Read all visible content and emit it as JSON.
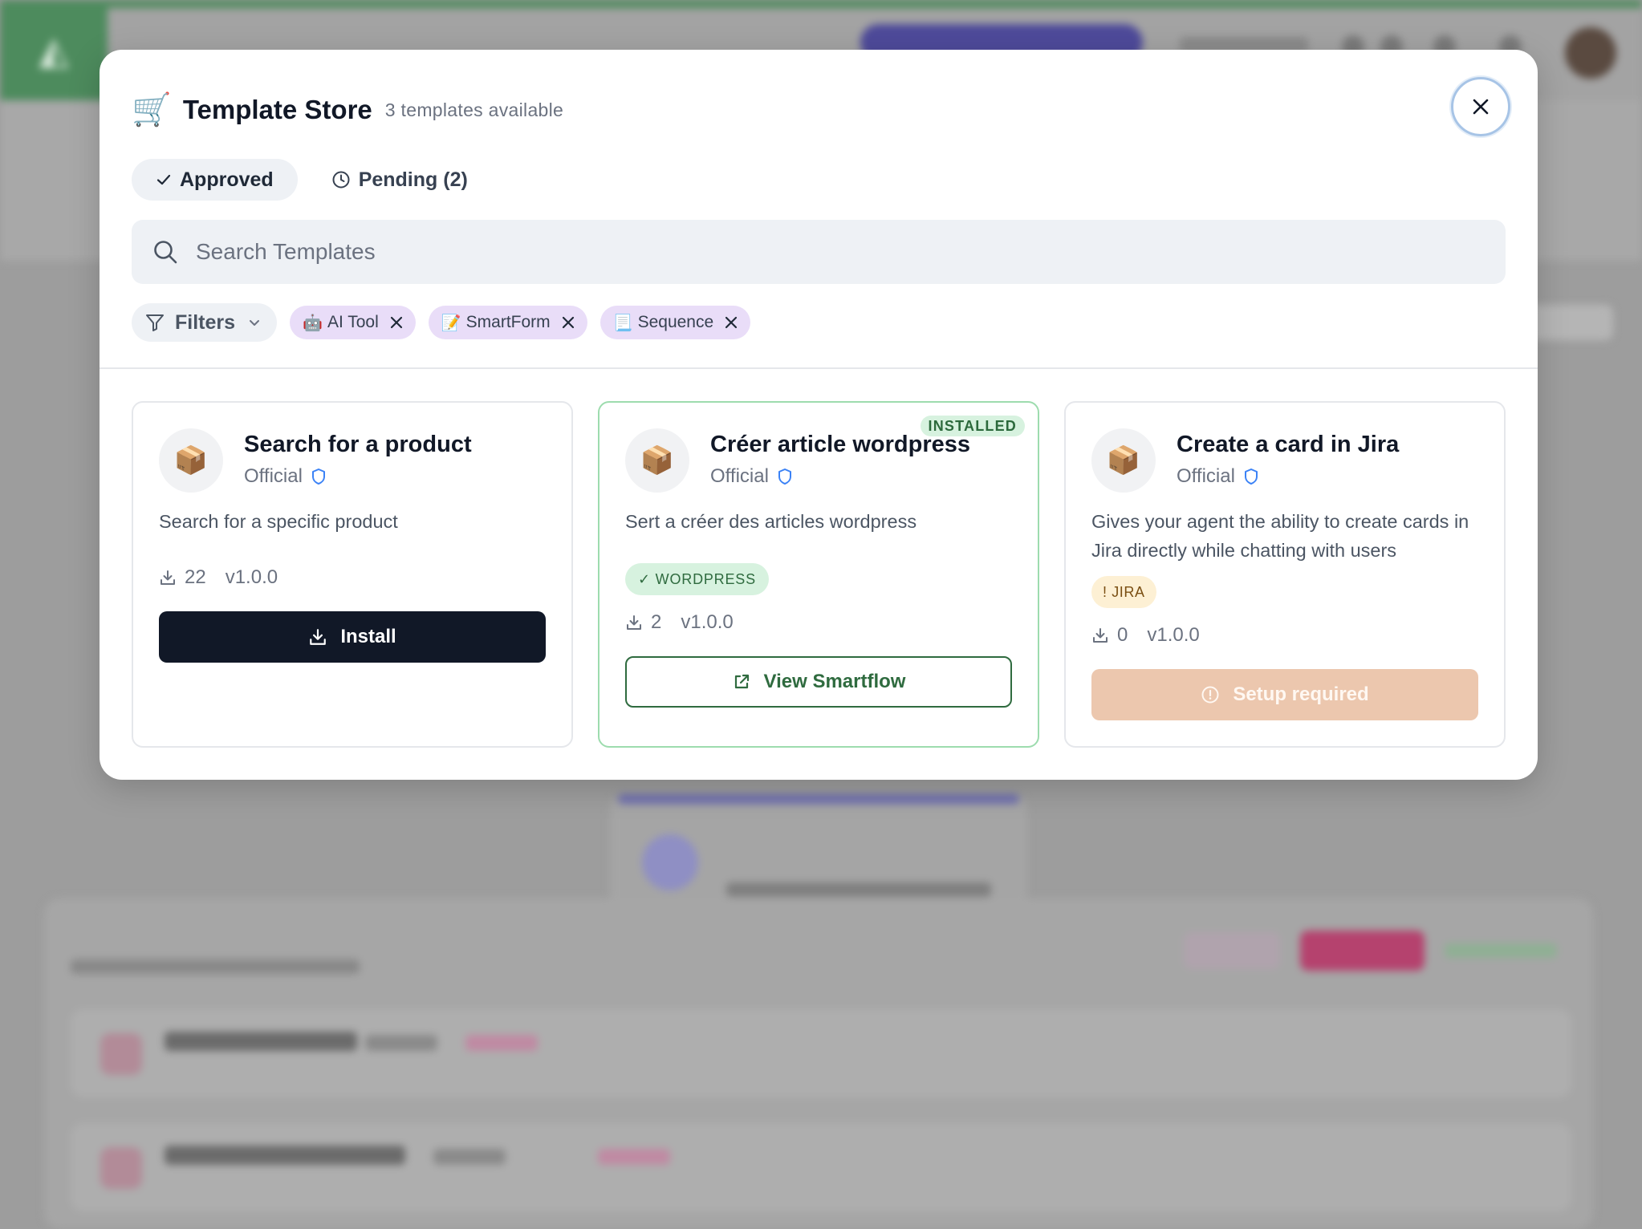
{
  "modal": {
    "title": "Template Store",
    "count": "3 templates available",
    "tabs": [
      {
        "label": "Approved",
        "active": true
      },
      {
        "label": "Pending (2)",
        "active": false
      }
    ],
    "search": {
      "placeholder": "Search Templates",
      "value": ""
    },
    "filters": {
      "label": "Filters",
      "chips": [
        {
          "emoji": "🤖",
          "label": "AI Tool"
        },
        {
          "emoji": "📝",
          "label": "SmartForm"
        },
        {
          "emoji": "📃",
          "label": "Sequence"
        }
      ]
    },
    "cards": [
      {
        "title": "Search for a product",
        "official": "Official",
        "description": "Search for a specific product",
        "downloads": "22",
        "version": "v1.0.0",
        "action": "Install"
      },
      {
        "title": "Créer article wordpress",
        "official": "Official",
        "description": "Sert a créer des articles wordpress",
        "status": "INSTALLED",
        "badge": "✓ WORDPRESS",
        "downloads": "2",
        "version": "v1.0.0",
        "action": "View Smartflow"
      },
      {
        "title": "Create a card in Jira",
        "official": "Official",
        "description": "Gives your agent the ability to create cards in Jira directly while chatting with users",
        "badge": "! JIRA",
        "downloads": "0",
        "version": "v1.0.0",
        "action": "Setup required"
      }
    ]
  },
  "colors": {
    "accent_green": "#2f6b3f",
    "installed_border": "#9ddcae",
    "chip_purple": "#e9ddf8",
    "setup_orange": "#ecc7ae",
    "dark_button": "#111827"
  },
  "icons": [
    "cart-icon",
    "close-icon",
    "check-icon",
    "clock-icon",
    "search-icon",
    "filter-icon",
    "chevron-down-icon",
    "package-icon",
    "shield-icon",
    "download-icon",
    "external-link-icon",
    "alert-circle-icon"
  ]
}
